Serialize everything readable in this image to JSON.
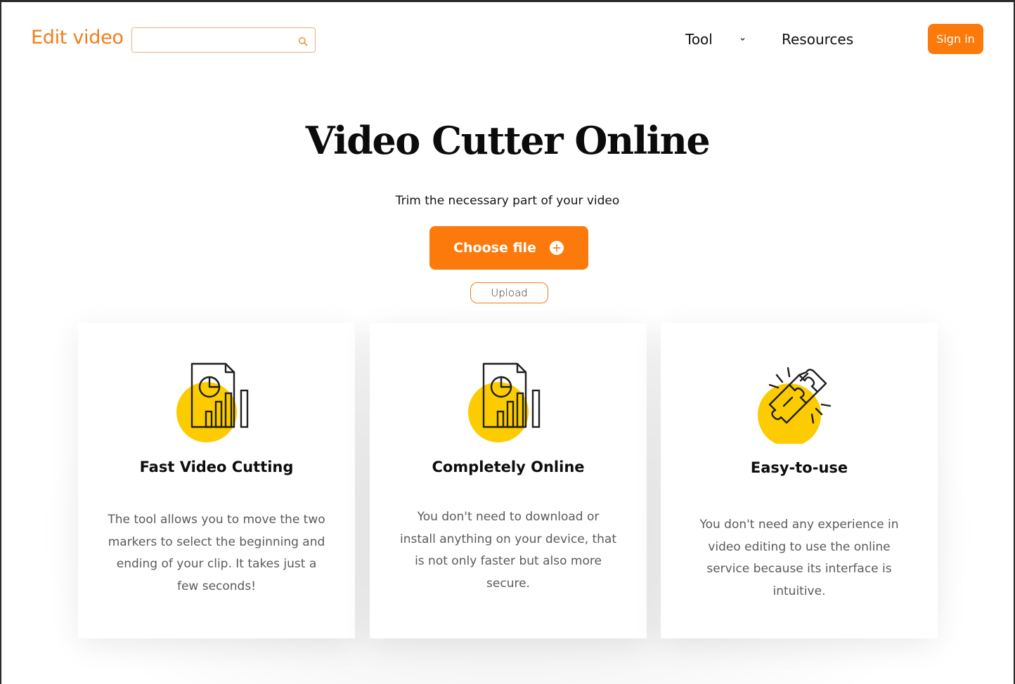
{
  "header": {
    "brand": "Edit video",
    "search": {
      "value": "",
      "placeholder": ""
    },
    "nav": {
      "tool": "Tool",
      "resources": "Resources"
    },
    "sign_in": "Sign in"
  },
  "hero": {
    "title": "Video Cutter Online",
    "subtitle": "Trim the necessary part of your video",
    "choose_file": "Choose file",
    "upload": "Upload"
  },
  "features": [
    {
      "icon": "document-chart-icon",
      "title": "Fast Video Cutting",
      "text": "The tool allows you to move the two markers to select the beginning and ending of your clip. It takes just a few seconds!"
    },
    {
      "icon": "document-chart-icon",
      "title": "Completely Online",
      "text": "You don't need to download or install anything on your device, that is not only faster but also more secure."
    },
    {
      "icon": "puzzle-icon",
      "title": "Easy-to-use",
      "text": "You don't need any experience in video editing to use the online service because its interface is intuitive."
    }
  ],
  "colors": {
    "accent": "#fb7a0b",
    "brand_text": "#f27d1a",
    "icon_circle": "#fccc00"
  }
}
